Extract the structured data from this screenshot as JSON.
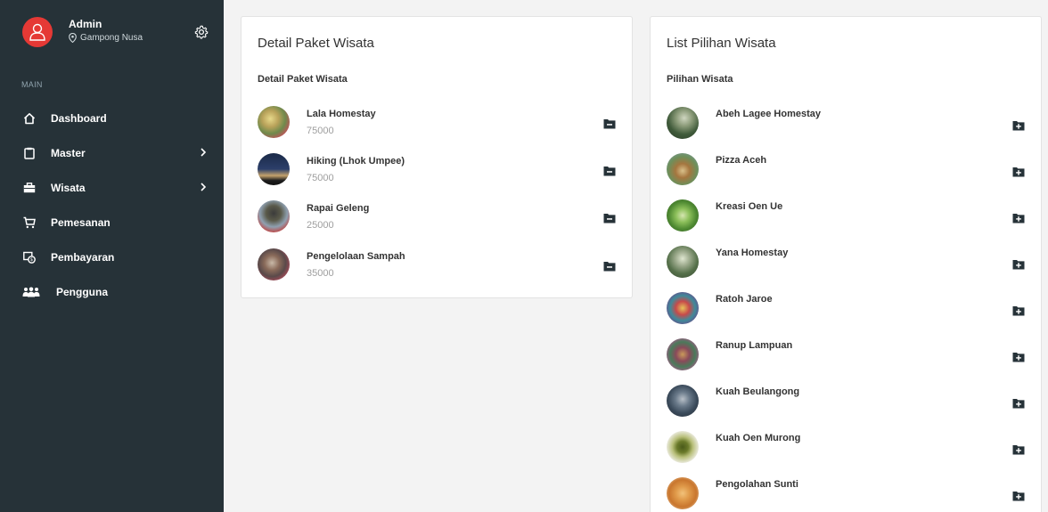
{
  "profile": {
    "name": "Admin",
    "location": "Gampong Nusa"
  },
  "sidebar": {
    "section_label": "MAIN",
    "items": [
      {
        "label": "Dashboard",
        "icon": "home-icon",
        "submenu": false
      },
      {
        "label": "Master",
        "icon": "clipboard-icon",
        "submenu": true
      },
      {
        "label": "Wisata",
        "icon": "briefcase-icon",
        "submenu": true
      },
      {
        "label": "Pemesanan",
        "icon": "cart-icon",
        "submenu": false
      },
      {
        "label": "Pembayaran",
        "icon": "payment-icon",
        "submenu": false
      },
      {
        "label": "Pengguna",
        "icon": "users-icon",
        "submenu": false
      }
    ]
  },
  "detail_card": {
    "title": "Detail Paket Wisata",
    "subtitle": "Detail Paket Wisata",
    "items": [
      {
        "name": "Lala Homestay",
        "price": "75000"
      },
      {
        "name": "Hiking (Lhok Umpee)",
        "price": "75000"
      },
      {
        "name": "Rapai Geleng",
        "price": "25000"
      },
      {
        "name": "Pengelolaan Sampah",
        "price": "35000"
      }
    ],
    "action_icon": "folder-remove-icon"
  },
  "list_card": {
    "title": "List Pilihan Wisata",
    "subtitle": "Pilihan Wisata",
    "items": [
      {
        "name": "Abeh Lagee Homestay"
      },
      {
        "name": "Pizza Aceh"
      },
      {
        "name": "Kreasi Oen Ue"
      },
      {
        "name": "Yana Homestay"
      },
      {
        "name": "Ratoh Jaroe"
      },
      {
        "name": "Ranup Lampuan"
      },
      {
        "name": "Kuah Beulangong"
      },
      {
        "name": "Kuah Oen Murong"
      },
      {
        "name": "Pengolahan Sunti"
      }
    ],
    "action_icon": "folder-add-icon"
  },
  "colors": {
    "sidebar_bg": "#263238",
    "avatar_bg": "#e53935",
    "page_bg": "#f3f3f3"
  }
}
